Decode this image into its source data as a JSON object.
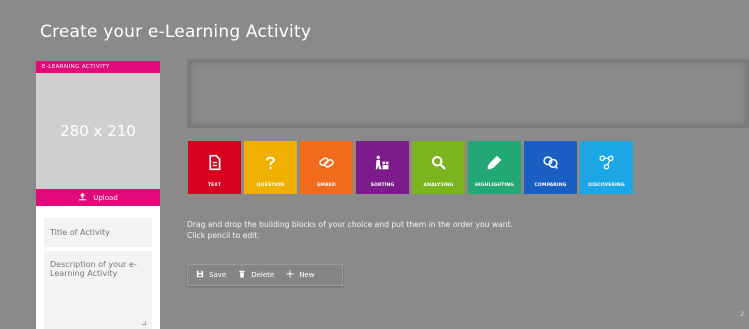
{
  "header": {
    "title": "Create your e-Learning Activity"
  },
  "left_panel": {
    "header_label": "E-LEARNING ACTIVITY",
    "image_placeholder": "280 x 210",
    "upload_label": "Upload",
    "title_placeholder": "Title of Activity",
    "description_placeholder": "Description of your e-Learning Activity"
  },
  "blocks": [
    {
      "label": "TEXT",
      "icon": "document-icon",
      "color": "#d7001e"
    },
    {
      "label": "QUESTION",
      "icon": "question-icon",
      "color": "#f0b000"
    },
    {
      "label": "EMBED",
      "icon": "link-icon",
      "color": "#f26a1b"
    },
    {
      "label": "SORTING",
      "icon": "sorting-icon",
      "color": "#7d1a8c"
    },
    {
      "label": "ANALYSING",
      "icon": "magnifier-icon",
      "color": "#7ab51d"
    },
    {
      "label": "HIGHLIGHTING",
      "icon": "highlighter-icon",
      "color": "#22a876"
    },
    {
      "label": "COMPARING",
      "icon": "compare-icon",
      "color": "#1a5fc4"
    },
    {
      "label": "DISCOVERING",
      "icon": "network-icon",
      "color": "#1ba6e6"
    }
  ],
  "instructions": {
    "line1": "Drag and drop the building blocks of your choice and put them in the order you want.",
    "line2": "Click pencil to edit."
  },
  "toolbar": {
    "save_label": "Save",
    "delete_label": "Delete",
    "new_label": "New"
  },
  "corner_number": "2.",
  "colors": {
    "accent": "#e2097a",
    "background": "#8a8a8a"
  }
}
